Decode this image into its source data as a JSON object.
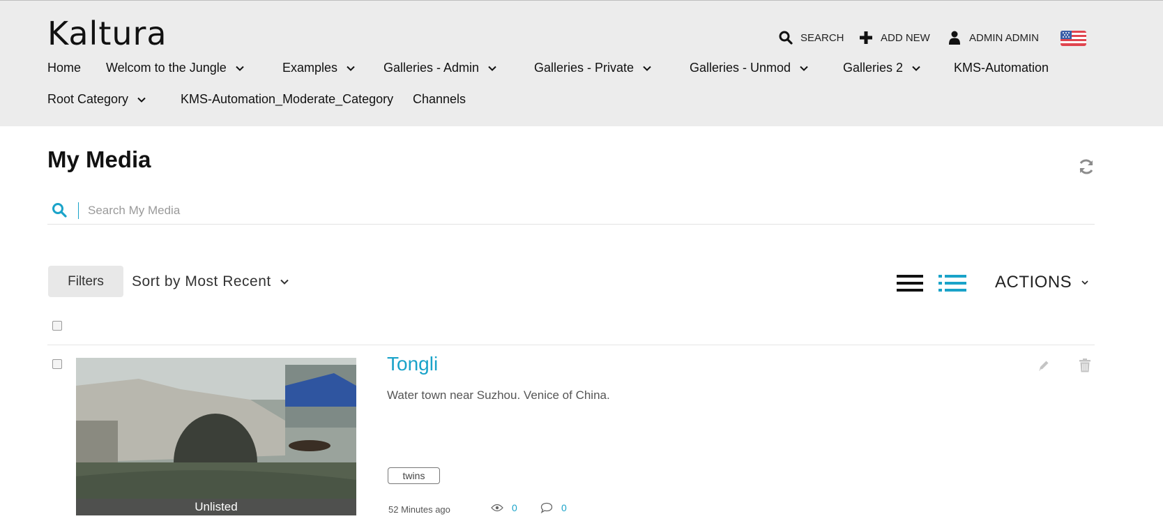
{
  "header": {
    "logo": "Kaltura",
    "search_label": "SEARCH",
    "add_new_label": "ADD NEW",
    "user_label": "ADMIN ADMIN",
    "flag_icon": "us-flag-icon"
  },
  "nav": {
    "items": [
      {
        "label": "Home",
        "has_dropdown": false
      },
      {
        "label": "Welcom to the Jungle",
        "has_dropdown": true
      },
      {
        "label": "Examples",
        "has_dropdown": true
      },
      {
        "label": "Galleries - Admin",
        "has_dropdown": true
      },
      {
        "label": "Galleries - Private",
        "has_dropdown": true
      },
      {
        "label": "Galleries - Unmod",
        "has_dropdown": true
      },
      {
        "label": "Galleries 2",
        "has_dropdown": true
      },
      {
        "label": "KMS-Automation",
        "has_dropdown": false
      },
      {
        "label": "Root Category",
        "has_dropdown": true
      },
      {
        "label": "KMS-Automation_Moderate_Category",
        "has_dropdown": false
      },
      {
        "label": "Channels",
        "has_dropdown": false
      }
    ]
  },
  "page": {
    "title": "My Media",
    "search_placeholder": "Search My Media",
    "filters_label": "Filters",
    "sort_label": "Sort by Most Recent",
    "actions_label": "ACTIONS"
  },
  "entries": [
    {
      "title": "Tongli",
      "description": "Water town near Suzhou. Venice of China.",
      "status": "Unlisted",
      "tag": "twins",
      "time": "52 Minutes ago",
      "views": "0",
      "comments": "0"
    }
  ],
  "colors": {
    "accent": "#1aa3c9",
    "header_bg": "#ececec"
  }
}
